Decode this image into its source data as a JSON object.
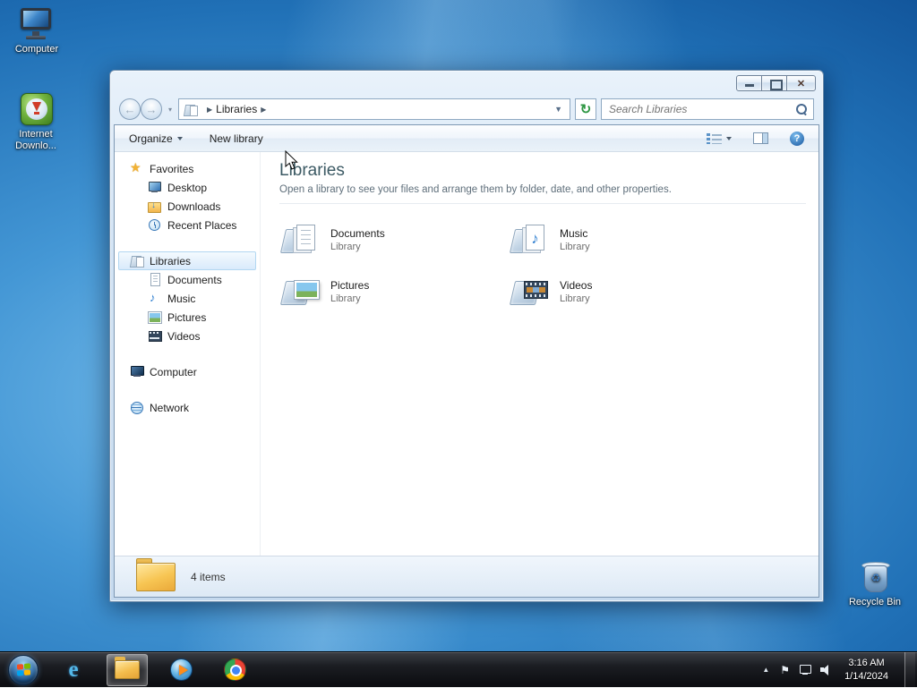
{
  "colors": {
    "aero_glass": "#d4e4f4",
    "selection_highlight": "#d9eafb",
    "header_text": "#3c5a64",
    "taskbar": "#0d0e12"
  },
  "desktop": {
    "icons": {
      "computer": {
        "label": "Computer"
      },
      "idm": {
        "label": "Internet Downlo..."
      },
      "recycle": {
        "label": "Recycle Bin"
      }
    }
  },
  "window": {
    "nav": {
      "breadcrumb": {
        "root_label": "Libraries"
      },
      "search": {
        "placeholder": "Search Libraries"
      }
    },
    "toolbar": {
      "organize_label": "Organize",
      "new_library_label": "New library"
    },
    "sidebar": {
      "favorites": {
        "label": "Favorites",
        "items": [
          {
            "label": "Desktop"
          },
          {
            "label": "Downloads"
          },
          {
            "label": "Recent Places"
          }
        ]
      },
      "libraries": {
        "label": "Libraries",
        "items": [
          {
            "label": "Documents"
          },
          {
            "label": "Music"
          },
          {
            "label": "Pictures"
          },
          {
            "label": "Videos"
          }
        ]
      },
      "computer": {
        "label": "Computer"
      },
      "network": {
        "label": "Network"
      }
    },
    "main": {
      "title": "Libraries",
      "subtitle": "Open a library to see your files and arrange them by folder, date, and other properties.",
      "items": [
        {
          "name": "Documents",
          "type": "Library"
        },
        {
          "name": "Music",
          "type": "Library"
        },
        {
          "name": "Pictures",
          "type": "Library"
        },
        {
          "name": "Videos",
          "type": "Library"
        }
      ]
    },
    "statusbar": {
      "count": "4 items"
    }
  },
  "taskbar": {
    "clock": {
      "time": "3:16 AM",
      "date": "1/14/2024"
    }
  }
}
